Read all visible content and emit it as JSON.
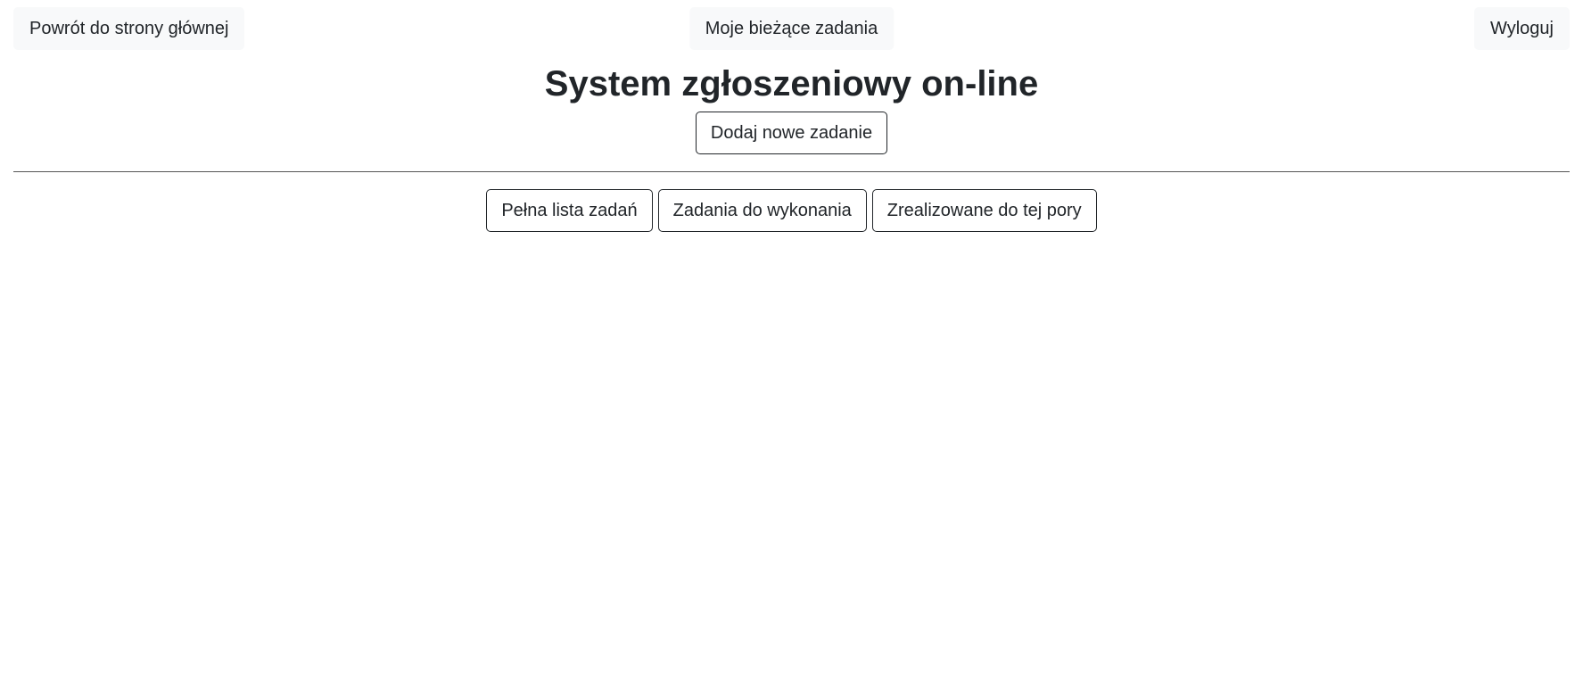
{
  "nav": {
    "home_label": "Powrót do strony głównej",
    "my_tasks_label": "Moje bieżące zadania",
    "logout_label": "Wyloguj"
  },
  "header": {
    "title": "System zgłoszeniowy on-line",
    "add_task_label": "Dodaj nowe zadanie"
  },
  "filters": {
    "all_label": "Pełna lista zadań",
    "todo_label": "Zadania do wykonania",
    "done_label": "Zrealizowane do tej pory"
  },
  "colors": {
    "text": "#212529",
    "nav_button_bg": "#f8f9fa",
    "divider": "#555555",
    "background": "#ffffff"
  }
}
